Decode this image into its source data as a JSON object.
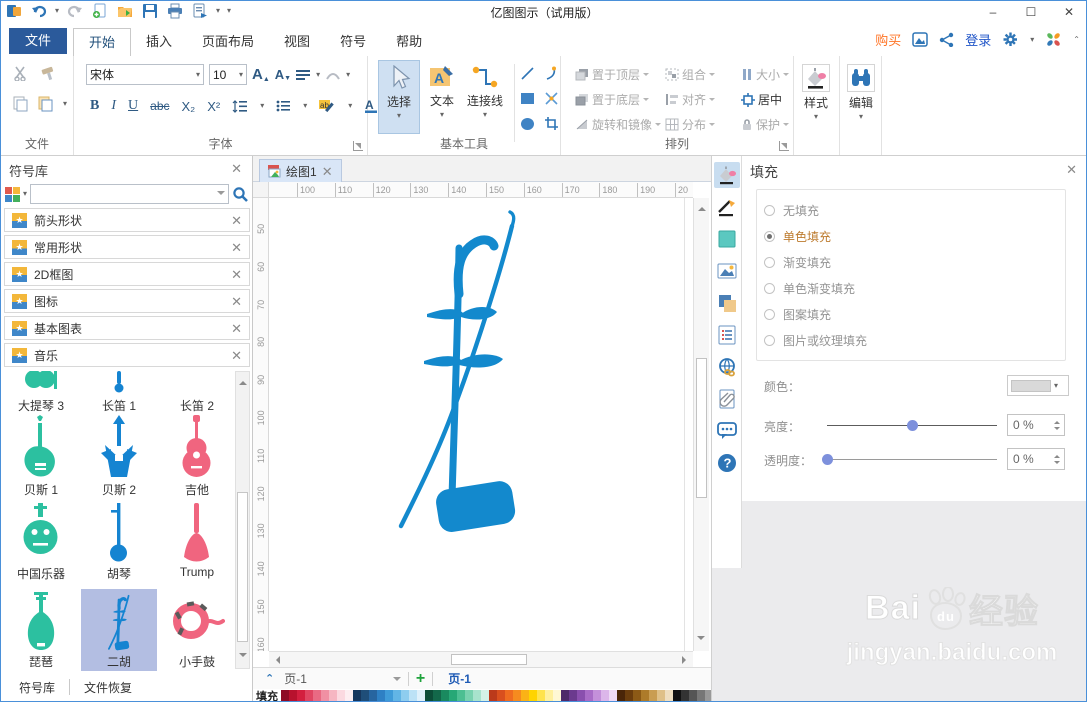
{
  "titlebar": {
    "title": "亿图图示（试用版）",
    "qat_icons": [
      "app-logo",
      "undo",
      "redo",
      "new-document",
      "open-folder",
      "save",
      "print",
      "export",
      "customize"
    ],
    "window_controls": [
      "minimize",
      "maximize",
      "close"
    ]
  },
  "tabrow": {
    "file_button": "文件",
    "tabs": [
      "开始",
      "插入",
      "页面布局",
      "视图",
      "符号",
      "帮助"
    ],
    "active_tab": "开始",
    "buy_label": "购买",
    "login_label": "登录"
  },
  "ribbon": {
    "group_labels": {
      "file": "文件",
      "font": "字体",
      "basic_tools": "基本工具",
      "arrange": "排列",
      "style": "样式",
      "edit": "编辑"
    },
    "font": {
      "family": "宋体",
      "size": "10",
      "bold": "B",
      "italic": "I",
      "underline": "U",
      "strike": "abc",
      "subscript": "X₂",
      "superscript": "X²"
    },
    "basic_tools": {
      "select": "选择",
      "text": "文本",
      "connector": "连接线"
    },
    "arrange": {
      "items": [
        {
          "label": "置于顶层",
          "enabled": false
        },
        {
          "label": "组合",
          "enabled": false
        },
        {
          "label": "大小",
          "enabled": false
        },
        {
          "label": "置于底层",
          "enabled": false
        },
        {
          "label": "对齐",
          "enabled": false
        },
        {
          "label": "居中",
          "enabled": true
        },
        {
          "label": "旋转和镜像",
          "enabled": false
        },
        {
          "label": "分布",
          "enabled": false
        },
        {
          "label": "保护",
          "enabled": false
        }
      ]
    },
    "style_label": "样式",
    "edit_label": "编辑"
  },
  "sidebar": {
    "title": "符号库",
    "search_placeholder": "",
    "categories": [
      "箭头形状",
      "常用形状",
      "2D框图",
      "图标",
      "基本图表",
      "音乐"
    ],
    "symbols": [
      {
        "label": "大提琴 3",
        "selected": false
      },
      {
        "label": "长笛 1",
        "selected": false
      },
      {
        "label": "长笛 2",
        "selected": false
      },
      {
        "label": "贝斯 1",
        "selected": false
      },
      {
        "label": "贝斯 2",
        "selected": false
      },
      {
        "label": "吉他",
        "selected": false
      },
      {
        "label": "中国乐器",
        "selected": false
      },
      {
        "label": "胡琴",
        "selected": false
      },
      {
        "label": "Trump",
        "selected": false
      },
      {
        "label": "琵琶",
        "selected": false
      },
      {
        "label": "二胡",
        "selected": true
      },
      {
        "label": "小手鼓",
        "selected": false
      }
    ],
    "bottom_tabs": [
      "符号库",
      "文件恢复"
    ]
  },
  "canvas": {
    "doc_tab": "绘图1",
    "h_ruler": [
      "100",
      "110",
      "120",
      "130",
      "140",
      "150",
      "160",
      "170",
      "180",
      "190",
      "20"
    ],
    "v_ruler": [
      "50",
      "60",
      "70",
      "80",
      "90",
      "100",
      "110",
      "120",
      "130",
      "140",
      "150",
      "160"
    ],
    "page_dropdown": "页-1",
    "add_page": "+",
    "active_page_tab": "页-1",
    "fill_strip_label": "填充",
    "drawing": "erhu-shape",
    "palette": [
      "#8e0b25",
      "#b8122e",
      "#d31f3f",
      "#e04562",
      "#e96a83",
      "#f090a3",
      "#f6b6c2",
      "#fbd9e0",
      "#fdeef1",
      "#17375e",
      "#1f4e79",
      "#2765a0",
      "#2e80c4",
      "#3f9bd8",
      "#62b5e5",
      "#8ecdef",
      "#bce2f6",
      "#e0f1fb",
      "#0c4d38",
      "#13684a",
      "#1a8a5f",
      "#27a876",
      "#4cbf92",
      "#79d2af",
      "#a8e3cc",
      "#d4f2e6",
      "#bb3a1b",
      "#d94f1e",
      "#ef6c20",
      "#f68b1f",
      "#fbb216",
      "#ffd400",
      "#ffe34d",
      "#fff09e",
      "#fff8d4",
      "#4e2a69",
      "#6b3a8e",
      "#8a4fae",
      "#a96cc7",
      "#c490da",
      "#dcb6ea",
      "#efdaf6",
      "#4a2508",
      "#6b3d0d",
      "#8c5a16",
      "#ad7b2a",
      "#c99d52",
      "#dfc088",
      "#efdec0",
      "#111111",
      "#333333",
      "#555555",
      "#777777",
      "#999999",
      "#b5b5b5",
      "#d2d2d2",
      "#ececec"
    ]
  },
  "fill_panel": {
    "title": "填充",
    "options": [
      {
        "label": "无填充",
        "selected": false
      },
      {
        "label": "单色填充",
        "selected": true
      },
      {
        "label": "渐变填充",
        "selected": false
      },
      {
        "label": "单色渐变填充",
        "selected": false
      },
      {
        "label": "图案填充",
        "selected": false
      },
      {
        "label": "图片或纹理填充",
        "selected": false
      }
    ],
    "color_label": "颜色：",
    "brightness_label": "亮度：",
    "brightness_value": "0 %",
    "brightness_percent": 50,
    "transparency_label": "透明度：",
    "transparency_value": "0 %",
    "transparency_percent": 0,
    "side_icons": [
      "fill",
      "line-style",
      "shape",
      "picture",
      "shadow",
      "page-list",
      "hyperlink",
      "attachment",
      "comment",
      "help"
    ]
  },
  "watermark": {
    "brand_left": "Bai",
    "brand_paw": "du",
    "brand_right": "经验",
    "url": "jingyan.baidu.com"
  },
  "colors": {
    "accent": "#2e75b6",
    "erhu_blue": "#1389cd",
    "symbol_green": "#2cc0a0",
    "symbol_blue": "#1584d1",
    "symbol_pink": "#f0657f",
    "selected_cell": "#b3bee2",
    "file_button": "#2b5a9b"
  }
}
